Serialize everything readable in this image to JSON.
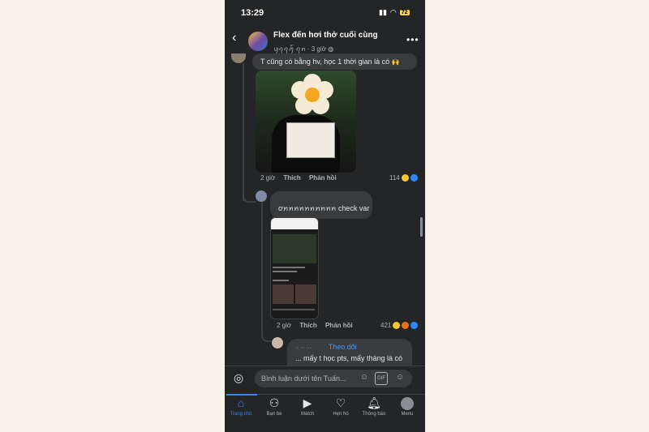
{
  "status_bar": {
    "time": "13:29",
    "battery": "72"
  },
  "header": {
    "title": "Flex đến hơi thở cuối cùng",
    "subtitle": "ꪗꪖꪖꪑ꫁ ꪖꪀ · 3 giờ"
  },
  "comments": [
    {
      "text": "T cũng có bằng hv, học 1 thời gian là có",
      "time": "2 giờ",
      "like": "Thích",
      "reply": "Phản hồi",
      "reactions": "114"
    },
    {
      "text": "ơꪀꪀꪀꪀꪀꪀꪀꪀꪀꪀ check var",
      "time": "2 giờ",
      "like": "Thích",
      "reply": "Phản hồi",
      "reactions": "421"
    },
    {
      "follow": "Theo dõi",
      "text": "... mấy t học pts, mấy tháng là có"
    }
  ],
  "composer": {
    "placeholder": "Bình luận dưới tên Tuấn..."
  },
  "nav": [
    {
      "label": "Trang chủ",
      "icon": "home-icon",
      "active": true
    },
    {
      "label": "Bạn bè",
      "icon": "friends-icon"
    },
    {
      "label": "Watch",
      "icon": "watch-icon"
    },
    {
      "label": "Hẹn hò",
      "icon": "heart-icon"
    },
    {
      "label": "Thông báo",
      "icon": "bell-icon"
    },
    {
      "label": "Menu",
      "icon": "menu-avatar-icon"
    }
  ],
  "colors": {
    "accent": "#2d88ff",
    "background": "#242526",
    "bubble": "#3a3b3c"
  }
}
